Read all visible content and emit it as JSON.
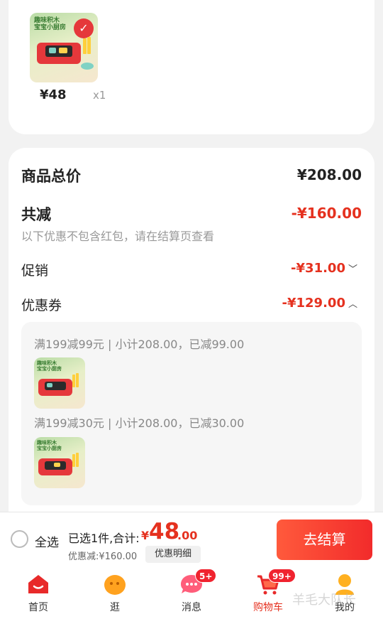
{
  "top_item": {
    "price": "¥48",
    "qty": "x1",
    "product_caption": "趣味积木\n宝宝小厨房"
  },
  "summary": {
    "total_label": "商品总价",
    "total_value": "¥208.00",
    "reduce_label": "共减",
    "reduce_value": "-¥160.00",
    "reduce_note": "以下优惠不包含红包，请在结算页查看",
    "promo_label": "促销",
    "promo_value": "-¥31.00",
    "coupon_label": "优惠券",
    "coupon_value": "-¥129.00"
  },
  "coupons": [
    {
      "text": "满199减99元 | 小计208.00，已减99.00"
    },
    {
      "text": "满199减30元 | 小计208.00，已减30.00"
    }
  ],
  "bottom_bar": {
    "select_all": "全选",
    "selected_text": "已选1件,合计:",
    "yuan": "¥",
    "amount_int": "48",
    "amount_dec": ".00",
    "discount_note": "优惠减:¥160.00",
    "detail_button": "优惠明细",
    "checkout_button": "去结算"
  },
  "tabbar": {
    "items": [
      {
        "label": "首页",
        "icon": "home-icon",
        "badge": ""
      },
      {
        "label": "逛",
        "icon": "browse-icon",
        "badge": ""
      },
      {
        "label": "消息",
        "icon": "message-icon",
        "badge": "5+"
      },
      {
        "label": "购物车",
        "icon": "cart-icon",
        "badge": "99+"
      },
      {
        "label": "我的",
        "icon": "profile-icon",
        "badge": ""
      }
    ]
  },
  "watermark": "羊毛大队长",
  "colors": {
    "accent_red": "#e5311f",
    "checkout_gradient_start": "#ff5a3c",
    "checkout_gradient_end": "#f22b2b",
    "background": "#f2f2f2"
  }
}
